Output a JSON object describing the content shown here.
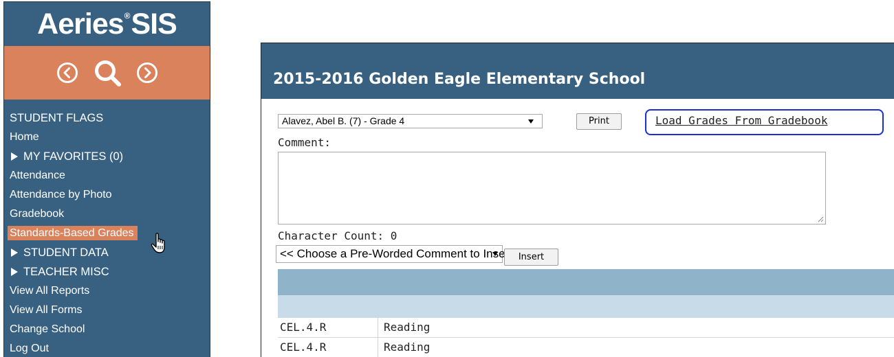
{
  "sidebar": {
    "logo_text": "Aeries",
    "logo_mark": "®",
    "logo_suffix": "SIS",
    "nav_icons": [
      "chevron-left-circle-icon",
      "search-icon",
      "chevron-right-circle-icon"
    ],
    "items": [
      {
        "label": "STUDENT FLAGS"
      },
      {
        "label": "Home"
      },
      {
        "label": "MY FAVORITES (0)",
        "expandable": true
      },
      {
        "label": "Attendance"
      },
      {
        "label": "Attendance by Photo"
      },
      {
        "label": "Gradebook"
      },
      {
        "label": "Standards-Based Grades",
        "active": true
      },
      {
        "label": "STUDENT DATA",
        "expandable": true
      },
      {
        "label": "TEACHER MISC",
        "expandable": true
      },
      {
        "label": "View All Reports"
      },
      {
        "label": "View All Forms"
      },
      {
        "label": "Change School"
      },
      {
        "label": "Log Out"
      }
    ]
  },
  "header": {
    "title": "2015-2016 Golden Eagle Elementary School"
  },
  "form": {
    "student_selected": "Alavez, Abel B. (7) - Grade 4",
    "print_label": "Print",
    "load_grades_label": "Load Grades From Gradebook",
    "comment_label": "Comment:",
    "comment_value": "",
    "char_count_label": "Character Count: 0",
    "preworded_selected": "<< Choose a Pre-Worded Comment to Insert >>",
    "insert_label": "Insert"
  },
  "grid": {
    "rows": [
      {
        "code": "CEL.4.R",
        "description": "Reading"
      },
      {
        "code": "CEL.4.R",
        "description": "Reading"
      }
    ]
  },
  "colors": {
    "sidebar_bg": "#386181",
    "accent_orange": "#d9825b",
    "highlight_box": "#1a2ed1",
    "grid_header_dark": "#8fb4ca",
    "grid_header_light": "#c7dce8"
  }
}
